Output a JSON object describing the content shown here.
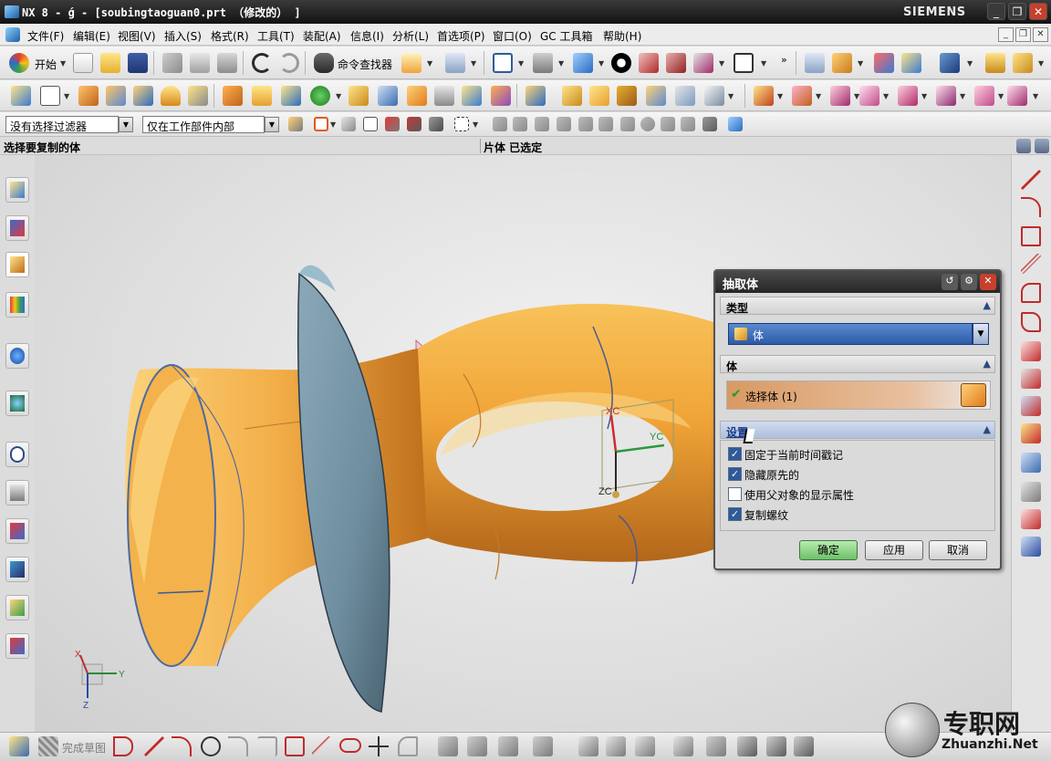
{
  "window": {
    "title": "NX 8 - ǵ - [soubingtaoguan0.prt （修改的） ]",
    "brand": "SIEMENS",
    "minimize": "_",
    "restore": "❐",
    "close": "✕"
  },
  "menu": {
    "items": [
      "文件(F)",
      "编辑(E)",
      "视图(V)",
      "插入(S)",
      "格式(R)",
      "工具(T)",
      "装配(A)",
      "信息(I)",
      "分析(L)",
      "首选项(P)",
      "窗口(O)",
      "GC 工具箱",
      "帮助(H)"
    ]
  },
  "toolbar": {
    "start_label": "开始",
    "command_finder_label": "命令查找器"
  },
  "filters": {
    "type_filter": "没有选择过滤器",
    "scope_filter": "仅在工作部件内部"
  },
  "status": {
    "prompt": "选择要复制的体",
    "info": "片体 已选定"
  },
  "viewport": {
    "wcs_labels": {
      "xc": "XC",
      "yc": "YC",
      "zc": "ZC"
    },
    "abs_axes": {
      "x": "X",
      "y": "Y",
      "z": "Z"
    }
  },
  "dialog": {
    "title": "抽取体",
    "section_type": "类型",
    "type_value": "体",
    "section_body": "体",
    "select_body": "选择体 (1)",
    "section_settings": "设置",
    "options": [
      {
        "label": "固定于当前时间戳记",
        "checked": true
      },
      {
        "label": "隐藏原先的",
        "checked": true
      },
      {
        "label": "使用父对象的显示属性",
        "checked": false
      },
      {
        "label": "复制螺纹",
        "checked": true
      }
    ],
    "ok": "确定",
    "apply": "应用",
    "cancel": "取消"
  },
  "sketch_bar": {
    "finish_sketch": "完成草图"
  },
  "watermark": {
    "name": "专职网",
    "url": "Zhuanzhi.Net"
  },
  "colors": {
    "model_orange": "#f0a437",
    "flange_blue": "#6f8fa0",
    "dialog_selected_row": "#d89a63",
    "menu_bg": "#ececec",
    "ok_button": "#8fd08a"
  }
}
